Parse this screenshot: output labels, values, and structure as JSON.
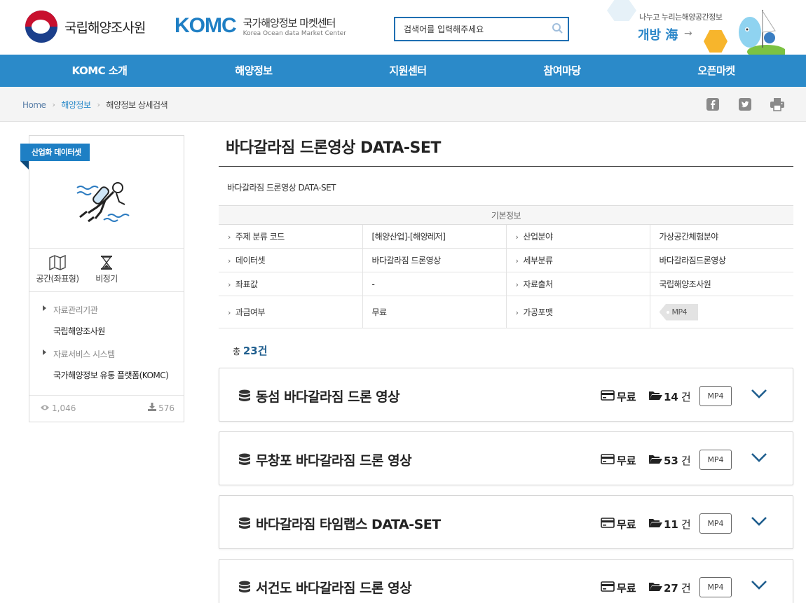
{
  "header": {
    "org_name": "국립해양조사원",
    "brand": "KOMC",
    "brand_kr": "국가해양정보 마켓센터",
    "brand_en": "Korea Ocean data Market Center",
    "search_placeholder": "검색어를 입력해주세요",
    "promo_small": "나누고 누리는해양공간정보",
    "promo_big": "개방 海"
  },
  "nav": {
    "items": [
      "KOMC 소개",
      "해양정보",
      "지원센터",
      "참여마당",
      "오픈마켓"
    ]
  },
  "breadcrumb": {
    "home": "Home",
    "level1": "해양정보",
    "level2": "해양정보 상세검색"
  },
  "sidebar": {
    "ribbon": "산업화 데이터셋",
    "categories": [
      "공간(좌표형)",
      "비정기"
    ],
    "agency_label": "자료관리기관",
    "agency_value": "국립해양조사원",
    "system_label": "자료서비스 시스템",
    "system_value": "국가해양정보 유통 플랫폼(KOMC)",
    "views": "1,046",
    "downloads": "576"
  },
  "main": {
    "title": "바다갈라짐 드론영상 DATA-SET",
    "subtitle": "바다갈라짐 드론영상 DATA-SET",
    "info_header": "기본정보",
    "info": [
      {
        "k1": "주제 분류 코드",
        "v1": "[해양산업]-[해양레저]",
        "k2": "산업분야",
        "v2": "가상공간체험분야"
      },
      {
        "k1": "데이터셋",
        "v1": "바다갈라짐 드론영상",
        "k2": "세부분류",
        "v2": "바다갈라짐드론영상"
      },
      {
        "k1": "좌표값",
        "v1": "-",
        "k2": "자료출처",
        "v2": "국립해양조사원"
      },
      {
        "k1": "과금여부",
        "v1": "무료",
        "k2": "가공포맷",
        "v2": "MP4"
      }
    ],
    "total_prefix": "총",
    "total_count": "23건",
    "datasets": [
      {
        "title": "동섬 바다갈라짐 드론 영상",
        "pay": "무료",
        "count": "14",
        "unit": "건",
        "format": "MP4"
      },
      {
        "title": "무창포 바다갈라짐 드론 영상",
        "pay": "무료",
        "count": "53",
        "unit": "건",
        "format": "MP4"
      },
      {
        "title": "바다갈라짐 타임랩스 DATA-SET",
        "pay": "무료",
        "count": "11",
        "unit": "건",
        "format": "MP4"
      },
      {
        "title": "서건도 바다갈라짐 드론 영상",
        "pay": "무료",
        "count": "27",
        "unit": "건",
        "format": "MP4"
      }
    ]
  },
  "colors": {
    "nav_bg": "#2b8ac9",
    "brand_blue": "#1f7fc4",
    "ribbon_bg": "#1e7fc4",
    "accent_dark": "#1f5e8e"
  }
}
